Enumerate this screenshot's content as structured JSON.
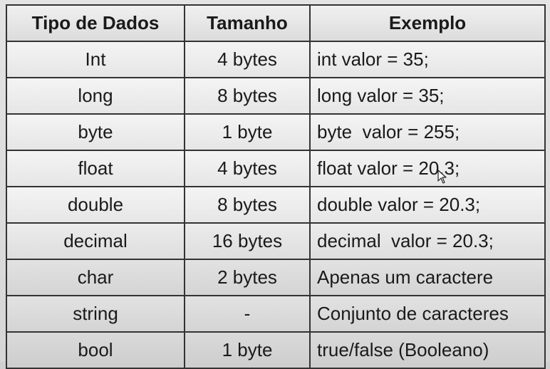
{
  "table": {
    "headers": [
      "Tipo de Dados",
      "Tamanho",
      "Exemplo"
    ],
    "rows": [
      {
        "type": "Int",
        "size": "4 bytes",
        "example": "int valor = 35;"
      },
      {
        "type": "long",
        "size": "8 bytes",
        "example": "long valor = 35;"
      },
      {
        "type": "byte",
        "size": "1 byte",
        "example": "byte  valor = 255;"
      },
      {
        "type": "float",
        "size": "4 bytes",
        "example": "float valor = 20.3;"
      },
      {
        "type": "double",
        "size": "8 bytes",
        "example": "double valor = 20.3;"
      },
      {
        "type": "decimal",
        "size": "16 bytes",
        "example": "decimal  valor = 20.3;"
      },
      {
        "type": "char",
        "size": "2 bytes",
        "example": "Apenas um caractere"
      },
      {
        "type": "string",
        "size": "-",
        "example": "Conjunto de caracteres"
      },
      {
        "type": "bool",
        "size": "1 byte",
        "example": "true/false (Booleano)"
      }
    ]
  },
  "cursor": {
    "icon": "mouse-pointer-icon"
  }
}
